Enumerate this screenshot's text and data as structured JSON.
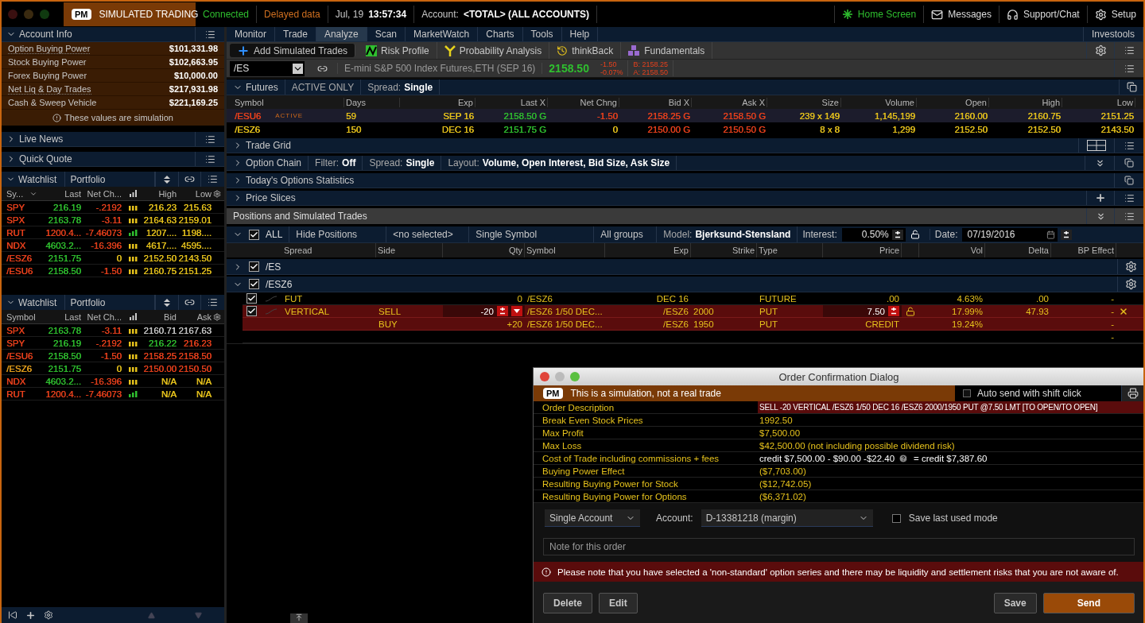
{
  "top_bar": {
    "badge": "PM",
    "mode": "SIMULATED TRADING",
    "connection": "Connected",
    "data_status": "Delayed data",
    "date": "Jul, 19",
    "time": "13:57:34",
    "account_label": "Account:",
    "account": "<TOTAL> (ALL ACCOUNTS)",
    "links": [
      {
        "label": "Home Screen",
        "kind": "home"
      },
      {
        "label": "Messages",
        "kind": "mail"
      },
      {
        "label": "Support/Chat",
        "kind": "headset"
      },
      {
        "label": "Setup",
        "kind": "gear"
      }
    ]
  },
  "account_info": {
    "title": "Account Info",
    "expanded": true,
    "rows": [
      {
        "label": "Option Buying Power",
        "value": "$101,331.98",
        "menu": true
      },
      {
        "label": "Stock Buying Power",
        "value": "$102,663.95",
        "menu": false
      },
      {
        "label": "Forex Buying Power",
        "value": "$10,000.00",
        "menu": false
      },
      {
        "label": "Net Liq & Day Trades",
        "value": "$217,931.98",
        "menu": true
      },
      {
        "label": "Cash & Sweep Vehicle",
        "value": "$221,169.25",
        "menu": false
      }
    ],
    "note": "These values are simulation"
  },
  "side_panels": [
    {
      "title": "Live News",
      "expanded": false
    },
    {
      "title": "Quick Quote",
      "expanded": false
    }
  ],
  "watchlists": [
    {
      "tabs": [
        "Watchlist",
        "Portfolio"
      ],
      "expanded": true,
      "sort_menu": true,
      "columns": [
        "Sy...",
        "Last",
        "Net Ch...",
        "High",
        "Low"
      ],
      "rows": [
        {
          "kind": "flat",
          "cells": [
            {
              "text": "SPY",
              "color": "#e8401c"
            },
            {
              "text": "216.19",
              "color": "#2fbf2f"
            },
            {
              "text": "-.2192",
              "color": "#e8401c"
            },
            {
              "text": "216.23",
              "color": "#e6c21c"
            },
            {
              "text": "215.63",
              "color": "#e6c21c"
            }
          ]
        },
        {
          "kind": "flat",
          "cells": [
            {
              "text": "SPX",
              "color": "#e8401c"
            },
            {
              "text": "2163.78",
              "color": "#2fbf2f"
            },
            {
              "text": "-3.11",
              "color": "#e8401c"
            },
            {
              "text": "2164.63",
              "color": "#e6c21c"
            },
            {
              "text": "2159.01",
              "color": "#e6c21c"
            }
          ]
        },
        {
          "kind": "rising",
          "cells": [
            {
              "text": "RUT",
              "color": "#e8401c"
            },
            {
              "text": "1200.4...",
              "color": "#e8401c"
            },
            {
              "text": "-7.46073",
              "color": "#e8401c"
            },
            {
              "text": "1207....",
              "color": "#e6c21c"
            },
            {
              "text": "1198....",
              "color": "#e6c21c"
            }
          ]
        },
        {
          "kind": "flat",
          "cells": [
            {
              "text": "NDX",
              "color": "#e8401c"
            },
            {
              "text": "4603.2...",
              "color": "#2fbf2f"
            },
            {
              "text": "-16.396",
              "color": "#e8401c"
            },
            {
              "text": "4617....",
              "color": "#e6c21c"
            },
            {
              "text": "4595....",
              "color": "#e6c21c"
            }
          ]
        },
        {
          "kind": "flat",
          "cells": [
            {
              "text": "/ESZ6",
              "color": "#e8401c"
            },
            {
              "text": "2151.75",
              "color": "#2fbf2f"
            },
            {
              "text": "0",
              "color": "#e6c21c"
            },
            {
              "text": "2152.50",
              "color": "#e6c21c"
            },
            {
              "text": "2143.50",
              "color": "#e6c21c"
            }
          ]
        },
        {
          "kind": "flat",
          "cells": [
            {
              "text": "/ESU6",
              "color": "#e8401c"
            },
            {
              "text": "2158.50",
              "color": "#2fbf2f"
            },
            {
              "text": "-1.50",
              "color": "#e8401c"
            },
            {
              "text": "2160.75",
              "color": "#e6c21c"
            },
            {
              "text": "2151.25",
              "color": "#e6c21c"
            }
          ]
        }
      ]
    },
    {
      "tabs": [
        "Watchlist",
        "Portfolio"
      ],
      "expanded": true,
      "sort_menu": false,
      "columns": [
        "Symbol",
        "Last",
        "Net Ch...",
        "Bid",
        "Ask"
      ],
      "rows": [
        {
          "kind": "flat",
          "cells": [
            {
              "text": "SPX",
              "color": "#e8401c"
            },
            {
              "text": "2163.78",
              "color": "#2fbf2f"
            },
            {
              "text": "-3.11",
              "color": "#e8401c"
            },
            {
              "text": "2160.71",
              "color": "#c8c8c8"
            },
            {
              "text": "2167.63",
              "color": "#c8c8c8"
            }
          ]
        },
        {
          "kind": "flat",
          "cells": [
            {
              "text": "SPY",
              "color": "#e8401c"
            },
            {
              "text": "216.19",
              "color": "#2fbf2f"
            },
            {
              "text": "-.2192",
              "color": "#e8401c"
            },
            {
              "text": "216.22",
              "color": "#2fbf2f"
            },
            {
              "text": "216.23",
              "color": "#e8401c"
            }
          ]
        },
        {
          "kind": "flat",
          "cells": [
            {
              "text": "/ESU6",
              "color": "#e8401c"
            },
            {
              "text": "2158.50",
              "color": "#2fbf2f"
            },
            {
              "text": "-1.50",
              "color": "#e8401c"
            },
            {
              "text": "2158.25",
              "color": "#e8401c"
            },
            {
              "text": "2158.50",
              "color": "#e8401c"
            }
          ]
        },
        {
          "kind": "flat",
          "cells": [
            {
              "text": "/ESZ6",
              "color": "#e6a01c"
            },
            {
              "text": "2151.75",
              "color": "#2fbf2f"
            },
            {
              "text": "0",
              "color": "#e6c21c"
            },
            {
              "text": "2150.00",
              "color": "#e8401c"
            },
            {
              "text": "2150.50",
              "color": "#e8401c"
            }
          ]
        },
        {
          "kind": "flat",
          "cells": [
            {
              "text": "NDX",
              "color": "#e8401c"
            },
            {
              "text": "4603.2...",
              "color": "#2fbf2f"
            },
            {
              "text": "-16.396",
              "color": "#e8401c"
            },
            {
              "text": "N/A",
              "color": "#e6c21c"
            },
            {
              "text": "N/A",
              "color": "#e6c21c"
            }
          ]
        },
        {
          "kind": "rising",
          "cells": [
            {
              "text": "RUT",
              "color": "#e8401c"
            },
            {
              "text": "1200.4...",
              "color": "#e8401c"
            },
            {
              "text": "-7.46073",
              "color": "#e8401c"
            },
            {
              "text": "N/A",
              "color": "#e6c21c"
            },
            {
              "text": "N/A",
              "color": "#e6c21c"
            }
          ]
        }
      ]
    }
  ],
  "main_tabs": [
    {
      "label": "Monitor",
      "selected": false
    },
    {
      "label": "Trade",
      "selected": false
    },
    {
      "label": "Analyze",
      "selected": true
    },
    {
      "label": "Scan",
      "selected": false
    },
    {
      "label": "MarketWatch",
      "selected": false
    },
    {
      "label": "Charts",
      "selected": false
    },
    {
      "label": "Tools",
      "selected": false
    },
    {
      "label": "Help",
      "selected": false
    }
  ],
  "right_tab": "Investools",
  "tools": [
    {
      "label": "Add Simulated Trades",
      "kind": "add"
    },
    {
      "label": "Risk Profile",
      "kind": "risk"
    },
    {
      "label": "Probability Analysis",
      "kind": "probability"
    },
    {
      "label": "thinkBack",
      "kind": "history"
    },
    {
      "label": "Fundamentals",
      "kind": "fundamentals"
    }
  ],
  "quote": {
    "symbol": "/ES",
    "description": "E-mini S&P 500 Index Futures,ETH (SEP 16)",
    "last": "2158.50",
    "change": "-1.50",
    "change_pct": "-0.07%",
    "bid": "B: 2158.25",
    "ask": "A: 2158.50"
  },
  "futures": {
    "title": "Futures",
    "expanded": true,
    "filter": "ACTIVE ONLY",
    "spread_label": "Spread:",
    "spread": "Single",
    "columns": [
      "Symbol",
      "Days",
      "Exp",
      "Last X",
      "Net Chng",
      "Bid X",
      "Ask X",
      "Size",
      "Volume",
      "Open",
      "High",
      "Low"
    ],
    "rows": [
      {
        "selected": true,
        "badge": "ACTIVE",
        "cells": [
          {
            "text": "/ESU6",
            "color": "#e8401c"
          },
          {
            "text": "59",
            "color": "#e6c21c"
          },
          {
            "text": "SEP 16",
            "color": "#e6c21c"
          },
          {
            "text": "2158.50 G",
            "color": "#2fbf2f"
          },
          {
            "text": "-1.50",
            "color": "#e8401c"
          },
          {
            "text": "2158.25 G",
            "color": "#e8401c"
          },
          {
            "text": "2158.50 G",
            "color": "#e8401c"
          },
          {
            "text": "239 x 149",
            "color": "#e6c21c"
          },
          {
            "text": "1,145,199",
            "color": "#e6c21c"
          },
          {
            "text": "2160.00",
            "color": "#e6c21c"
          },
          {
            "text": "2160.75",
            "color": "#e6c21c"
          },
          {
            "text": "2151.25",
            "color": "#e6c21c"
          }
        ]
      },
      {
        "selected": false,
        "cells": [
          {
            "text": "/ESZ6",
            "color": "#e6c21c"
          },
          {
            "text": "150",
            "color": "#e6c21c"
          },
          {
            "text": "DEC 16",
            "color": "#e6c21c"
          },
          {
            "text": "2151.75 G",
            "color": "#2fbf2f"
          },
          {
            "text": "0",
            "color": "#e6c21c"
          },
          {
            "text": "2150.00 G",
            "color": "#e8401c"
          },
          {
            "text": "2150.50 G",
            "color": "#e8401c"
          },
          {
            "text": "8 x 8",
            "color": "#e6c21c"
          },
          {
            "text": "1,299",
            "color": "#e6c21c"
          },
          {
            "text": "2152.50",
            "color": "#e6c21c"
          },
          {
            "text": "2152.50",
            "color": "#e6c21c"
          },
          {
            "text": "2143.50",
            "color": "#e6c21c"
          }
        ]
      }
    ]
  },
  "sections": [
    {
      "title": "Trade Grid",
      "expanded": false,
      "kind": "grid"
    },
    {
      "title": "Option Chain",
      "expanded": false,
      "kind": "chain",
      "filters": [
        {
          "label": "Filter:",
          "value": "Off"
        },
        {
          "label": "Spread:",
          "value": "Single"
        },
        {
          "label": "Layout:",
          "value": "Volume, Open Interest, Bid Size, Ask Size"
        }
      ]
    },
    {
      "title": "Today's Options Statistics",
      "expanded": false,
      "kind": "stats"
    },
    {
      "title": "Price Slices",
      "expanded": false,
      "kind": "slices"
    }
  ],
  "positions": {
    "title": "Positions and Simulated Trades",
    "expanded": true,
    "all_checked": true,
    "all_label": "ALL",
    "dropdowns": [
      "Hide Positions",
      "<no selected>",
      "Single Symbol",
      "All groups"
    ],
    "model_label": "Model:",
    "model": "Bjerksund-Stensland",
    "interest_label": "Interest:",
    "interest": "0.50%",
    "date_label": "Date:",
    "date": "07/19/2016",
    "columns": [
      "Spread",
      "Side",
      "Qty",
      "Symbol",
      "Exp",
      "Strike",
      "Type",
      "Price",
      "Vol",
      "Delta",
      "BP Effect"
    ],
    "groups": [
      {
        "symbol": "/ES",
        "expanded": false,
        "checked": true
      },
      {
        "symbol": "/ESZ6",
        "expanded": true,
        "checked": true,
        "rows": [
          {
            "kind": "position",
            "checked": true,
            "spread": "FUT",
            "qty": "0",
            "symbol": "/ESZ6",
            "exp": "DEC 16",
            "type": "FUTURE",
            "price": ".00",
            "vol": "4.63%",
            "delta": ".00",
            "bp": "-"
          },
          {
            "kind": "order",
            "checked": true,
            "editable": true,
            "spread": "VERTICAL",
            "side": "SELL",
            "qty": "-20",
            "symbol": "/ESZ6 1/50 DEC...",
            "exp": "/ESZ6",
            "strike": "2000",
            "type": "PUT",
            "price": "7.50",
            "vol": "17.99%",
            "delta": "47.93",
            "bp": "-"
          },
          {
            "kind": "order",
            "editable": false,
            "side": "BUY",
            "qty": "+20",
            "symbol": "/ESZ6 1/50 DEC...",
            "exp": "/ESZ6",
            "strike": "1950",
            "type": "PUT",
            "price": "CREDIT",
            "vol": "19.24%",
            "bp": "-"
          },
          {
            "kind": "blank",
            "bp": "-"
          }
        ]
      }
    ]
  },
  "dialog": {
    "title": "Order Confirmation Dialog",
    "badge": "PM",
    "banner": "This is a simulation, not a real trade",
    "auto_send": {
      "label": "Auto send with shift click",
      "checked": false
    },
    "details": [
      {
        "label": "Order Description",
        "value": "SELL -20 VERTICAL /ESZ6 1/50 DEC 16 /ESZ6 2000/1950 PUT @7.50 LMT [TO OPEN/TO OPEN]",
        "kind": "highlight"
      },
      {
        "label": "Break Even Stock Prices",
        "value": "1992.50",
        "kind": "plain"
      },
      {
        "label": "Max Profit",
        "value": "$7,500.00",
        "kind": "plain"
      },
      {
        "label": "Max Loss",
        "value": "$42,500.00 (not including possible dividend risk)",
        "kind": "plain"
      },
      {
        "label": "Cost of Trade including commissions + fees",
        "value": "credit $7,500.00 - $90.00 -$22.40",
        "result": "= credit $7,387.60",
        "kind": "formula"
      },
      {
        "label": "Buying Power Effect",
        "value": "($7,703.00)",
        "kind": "plain"
      },
      {
        "label": "Resulting Buying Power for Stock",
        "value": "($12,742.05)",
        "kind": "plain"
      },
      {
        "label": "Resulting Buying Power for Options",
        "value": "($6,371.02)",
        "kind": "plain"
      }
    ],
    "mode": "Single Account",
    "account_label": "Account:",
    "account": "D-13381218 (margin)",
    "save_mode": {
      "label": "Save last used mode",
      "checked": false
    },
    "note_placeholder": "Note for this order",
    "warning": "Please note that you have selected a 'non-standard' option series and there may be liquidity and settlement risks that you are not aware of.",
    "buttons": [
      {
        "label": "Delete",
        "kind": "secondary"
      },
      {
        "label": "Edit",
        "kind": "secondary"
      },
      {
        "label": "Save",
        "kind": "secondary"
      },
      {
        "label": "Send",
        "kind": "primary"
      }
    ]
  }
}
